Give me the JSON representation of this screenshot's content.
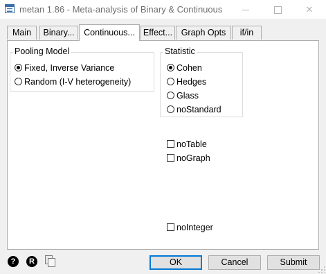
{
  "window": {
    "title": "metan 1.86 - Meta-analysis of Binary & Continuous"
  },
  "tabs": [
    {
      "label": "Main",
      "active": false
    },
    {
      "label": "Binary...",
      "active": false
    },
    {
      "label": "Continuous...",
      "active": true
    },
    {
      "label": "Effect...",
      "active": false
    },
    {
      "label": "Graph Opts",
      "active": false
    },
    {
      "label": "if/in",
      "active": false
    }
  ],
  "pooling": {
    "title": "Pooling Model",
    "options": [
      {
        "label": "Fixed, Inverse Variance",
        "selected": true
      },
      {
        "label": "Random (I-V heterogeneity)",
        "selected": false
      }
    ]
  },
  "statistic": {
    "title": "Statistic",
    "options": [
      {
        "label": "Cohen",
        "selected": true
      },
      {
        "label": "Hedges",
        "selected": false
      },
      {
        "label": "Glass",
        "selected": false
      },
      {
        "label": "noStandard",
        "selected": false
      }
    ]
  },
  "checkboxes": {
    "notable": {
      "label": "noTable",
      "checked": false
    },
    "nograph": {
      "label": "noGraph",
      "checked": false
    },
    "nointeger": {
      "label": "noInteger",
      "checked": false
    }
  },
  "bottom": {
    "help_icon": "?",
    "reset_icon": "R",
    "ok_label": "OK",
    "cancel_label": "Cancel",
    "submit_label": "Submit"
  },
  "colors": {
    "default_button_border": "#0078d7",
    "panel_bg": "#ffffff",
    "window_bg": "#f0f0f0"
  }
}
